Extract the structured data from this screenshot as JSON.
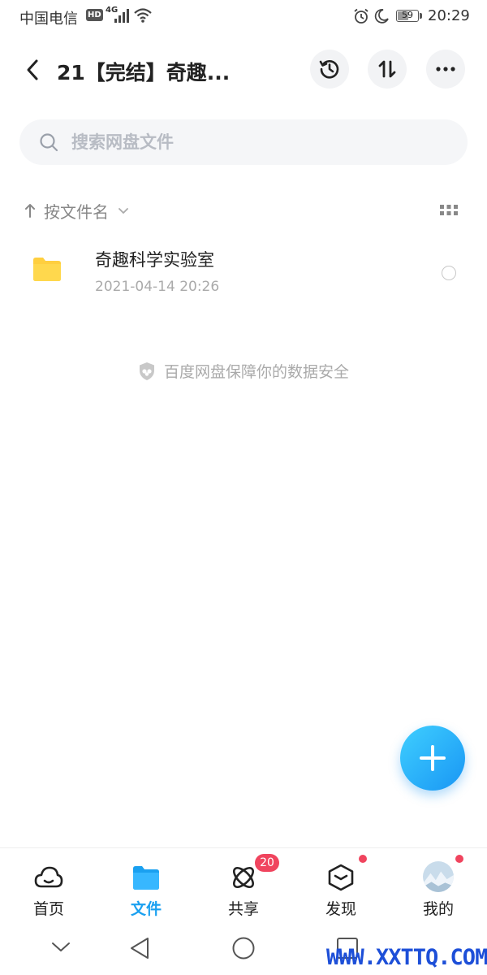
{
  "status_bar": {
    "carrier": "中国电信",
    "hd": "HD",
    "network": "4G",
    "battery": "59",
    "battery_level": 0.59,
    "time": "20:29"
  },
  "header": {
    "title": "21【完结】奇趣...",
    "icons": [
      "back-icon",
      "history-icon",
      "sort-icon",
      "more-icon"
    ]
  },
  "search": {
    "placeholder": "搜索网盘文件"
  },
  "sort": {
    "label": "按文件名"
  },
  "files": [
    {
      "name": "奇趣科学实验室",
      "date": "2021-04-14  20:26",
      "type": "folder"
    }
  ],
  "notice": "百度网盘保障你的数据安全",
  "bottom_nav": {
    "items": [
      {
        "label": "首页"
      },
      {
        "label": "文件"
      },
      {
        "label": "共享",
        "badge": "20"
      },
      {
        "label": "发现"
      },
      {
        "label": "我的"
      }
    ],
    "active_color": "#1aa0f0",
    "badge_color": "#f0445e"
  },
  "watermark": "WWW.XXTTQ.COM"
}
